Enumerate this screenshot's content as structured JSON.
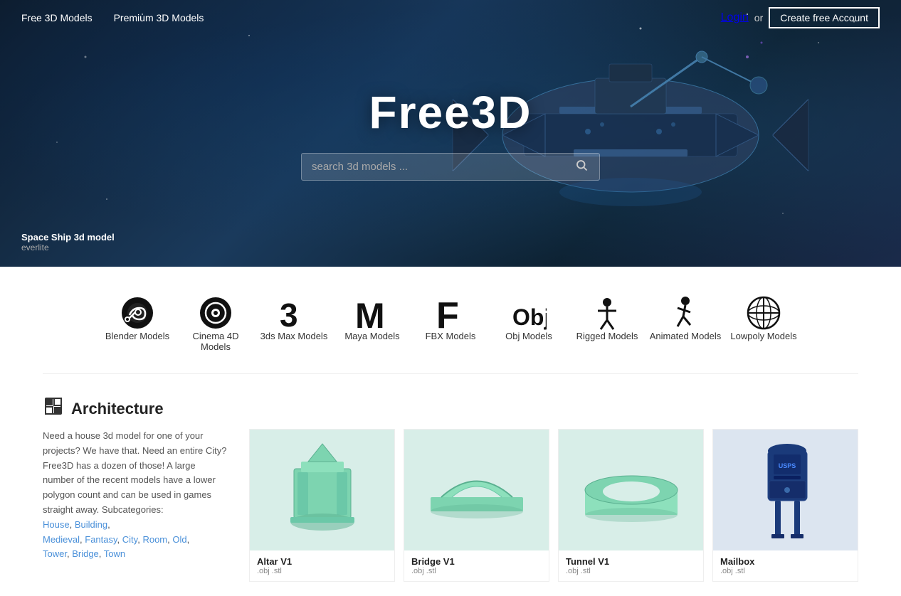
{
  "nav": {
    "links": [
      {
        "label": "Free 3D Models",
        "href": "#"
      },
      {
        "label": "Premium 3D Models",
        "href": "#"
      }
    ],
    "login_label": "Login",
    "or_label": "or",
    "create_account_label": "Create free Account"
  },
  "hero": {
    "title": "Free3D",
    "search_placeholder": "search 3d models ...",
    "model_name": "Space Ship 3d model",
    "model_author": "everlite"
  },
  "categories": [
    {
      "id": "blender",
      "label": "Blender Models",
      "icon": "blender"
    },
    {
      "id": "c4d",
      "label": "Cinema 4D Models",
      "icon": "c4d"
    },
    {
      "id": "3dsmax",
      "label": "3ds Max Models",
      "icon": "3dsmax"
    },
    {
      "id": "maya",
      "label": "Maya Models",
      "icon": "maya"
    },
    {
      "id": "fbx",
      "label": "FBX Models",
      "icon": "fbx"
    },
    {
      "id": "obj",
      "label": "Obj Models",
      "icon": "obj"
    },
    {
      "id": "rigged",
      "label": "Rigged Models",
      "icon": "rigged"
    },
    {
      "id": "animated",
      "label": "Animated Models",
      "icon": "animated"
    },
    {
      "id": "lowpoly",
      "label": "Lowpoly Models",
      "icon": "lowpoly"
    }
  ],
  "architecture": {
    "title": "Architecture",
    "description": "Need a house 3d model for one of your projects? We have that. Need an entire City? Free3D has a dozen of those! A large number of the recent models have a lower polygon count and can be used in games straight away. Subcategories:",
    "subcategories": [
      {
        "label": "House",
        "href": "#"
      },
      {
        "label": "Building",
        "href": "#"
      },
      {
        "label": "Medieval",
        "href": "#"
      },
      {
        "label": "Fantasy",
        "href": "#"
      },
      {
        "label": "City",
        "href": "#"
      },
      {
        "label": "Room",
        "href": "#"
      },
      {
        "label": "Old",
        "href": "#"
      },
      {
        "label": "Tower",
        "href": "#"
      },
      {
        "label": "Bridge",
        "href": "#"
      },
      {
        "label": "Town",
        "href": "#"
      }
    ],
    "models": [
      {
        "title": "Altar V1",
        "formats": ".obj .stl"
      },
      {
        "title": "Bridge V1",
        "formats": ".obj .stl"
      },
      {
        "title": "Tunnel V1",
        "formats": ".obj .stl"
      },
      {
        "title": "Mailbox",
        "formats": ".obj .stl"
      }
    ]
  }
}
